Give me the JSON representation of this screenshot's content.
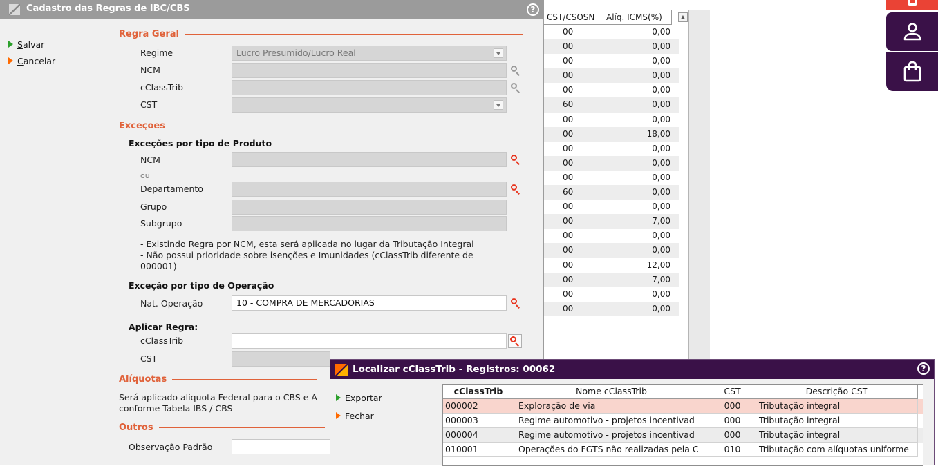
{
  "bg_grid": {
    "headers": [
      "CST/CSOSN",
      "Alíq. ICMS(%)"
    ],
    "rows": [
      [
        "00",
        "0,00"
      ],
      [
        "00",
        "0,00"
      ],
      [
        "00",
        "0,00"
      ],
      [
        "00",
        "0,00"
      ],
      [
        "00",
        "0,00"
      ],
      [
        "60",
        "0,00"
      ],
      [
        "00",
        "0,00"
      ],
      [
        "00",
        "18,00"
      ],
      [
        "00",
        "0,00"
      ],
      [
        "00",
        "0,00"
      ],
      [
        "00",
        "0,00"
      ],
      [
        "60",
        "0,00"
      ],
      [
        "00",
        "0,00"
      ],
      [
        "00",
        "7,00"
      ],
      [
        "00",
        "0,00"
      ],
      [
        "00",
        "0,00"
      ],
      [
        "00",
        "12,00"
      ],
      [
        "00",
        "7,00"
      ],
      [
        "00",
        "0,00"
      ],
      [
        "00",
        "0,00"
      ]
    ]
  },
  "dialog": {
    "title": "Cadastro das Regras de IBC/CBS",
    "help": "?",
    "menu": {
      "save": "Salvar",
      "cancel": "Cancelar"
    },
    "regra_geral": {
      "section": "Regra Geral",
      "regime_label": "Regime",
      "regime_value": "Lucro Presumido/Lucro Real",
      "ncm_label": "NCM",
      "cclasstrib_label": "cClassTrib",
      "cst_label": "CST"
    },
    "excecoes": {
      "section": "Exceções",
      "produto_title": "Exceções por tipo de Produto",
      "ncm_label": "NCM",
      "ou": "ou",
      "departamento_label": "Departamento",
      "grupo_label": "Grupo",
      "subgrupo_label": "Subgrupo",
      "note1": "- Existindo Regra por NCM, esta será aplicada no lugar da Tributação Integral",
      "note2": "- Não possui prioridade sobre isenções e Imunidades (cClassTrib diferente de",
      "note3": "000001)",
      "operacao_title": "Exceção por tipo de Operação",
      "nat_label": "Nat. Operação",
      "nat_value": "10 - COMPRA DE MERCADORIAS",
      "aplicar_title": "Aplicar Regra:",
      "aplicar_cclasstrib_label": "cClassTrib",
      "aplicar_cst_label": "CST"
    },
    "aliquotas": {
      "section": "Alíquotas",
      "text1": "Será aplicado alíquota Federal para o CBS e A",
      "text2": "conforme Tabela IBS / CBS"
    },
    "outros": {
      "section": "Outros",
      "obs_label": "Observação Padrão"
    }
  },
  "finder": {
    "title": "Localizar cClassTrib - Registros: 00062",
    "help": "?",
    "menu": {
      "export": "Exportar",
      "close": "Fechar"
    },
    "columns": [
      "cClassTrib",
      "Nome cClassTrib",
      "CST",
      "Descrição CST"
    ],
    "rows": [
      [
        "000002",
        "Exploração de via",
        "000",
        "Tributação integral"
      ],
      [
        "000003",
        "Regime automotivo - projetos incentivad",
        "000",
        "Tributação integral"
      ],
      [
        "000004",
        "Regime automotivo - projetos incentivad",
        "000",
        "Tributação integral"
      ],
      [
        "010001",
        "Operações do FGTS não realizadas pela C",
        "010",
        "Tributação com alíquotas uniforme"
      ]
    ]
  },
  "colors": {
    "accent": "#e0623a",
    "finder_title": "#3a1148",
    "selected_row": "#f9d5cd",
    "side_red": "#ea4335"
  }
}
